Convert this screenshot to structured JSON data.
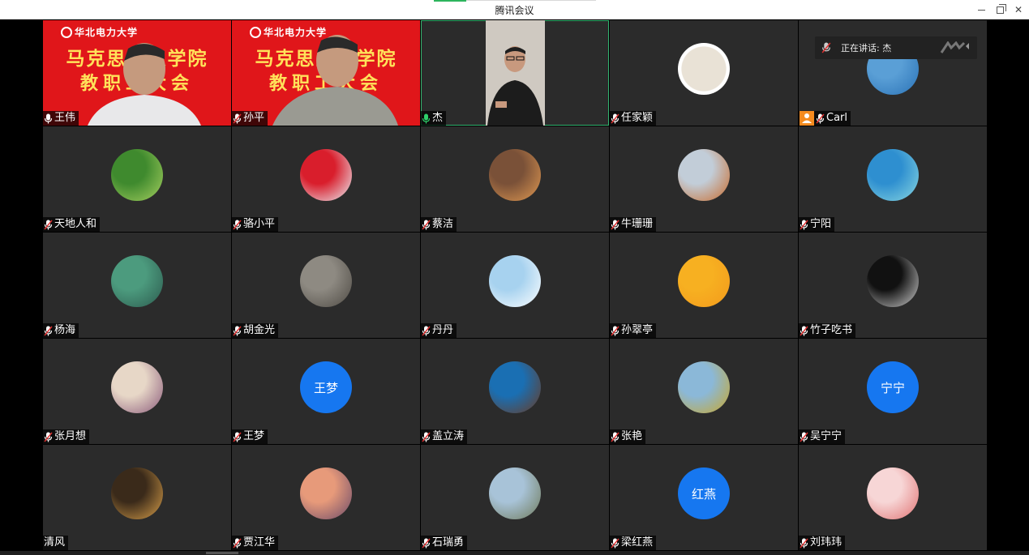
{
  "window": {
    "title": "腾讯会议",
    "controls": [
      "minimize",
      "maximize",
      "close"
    ]
  },
  "speaking": {
    "label": "正在讲话: 杰"
  },
  "participants": [
    {
      "name": "王伟",
      "type": "video-banner",
      "mic": "on"
    },
    {
      "name": "孙平",
      "type": "video-banner",
      "mic": "muted"
    },
    {
      "name": "杰",
      "type": "video",
      "mic": "speaking"
    },
    {
      "name": "任家颖",
      "type": "avatar-image",
      "mic": "muted",
      "colors": [
        "#e9e2d6",
        "#6f6a61"
      ]
    },
    {
      "name": "Carl",
      "type": "avatar-image",
      "mic": "muted",
      "host": true,
      "colors": [
        "#5a9fd6",
        "#2a72b6"
      ]
    },
    {
      "name": "天地人和",
      "type": "avatar-image",
      "mic": "muted",
      "colors": [
        "#3f8a2e",
        "#a7d060"
      ]
    },
    {
      "name": "骆小平",
      "type": "avatar-image",
      "mic": "muted",
      "colors": [
        "#d91e2c",
        "#eaf2f8"
      ]
    },
    {
      "name": "蔡洁",
      "type": "avatar-image",
      "mic": "muted",
      "colors": [
        "#7a5138",
        "#e29a52"
      ]
    },
    {
      "name": "牛珊珊",
      "type": "avatar-image",
      "mic": "muted",
      "colors": [
        "#c2cdd8",
        "#c96a2a"
      ]
    },
    {
      "name": "宁阳",
      "type": "avatar-image",
      "mic": "muted",
      "colors": [
        "#2e8fd0",
        "#8ad7e0"
      ]
    },
    {
      "name": "杨海",
      "type": "avatar-image",
      "mic": "muted",
      "colors": [
        "#4c9b7e",
        "#2c5a4e"
      ]
    },
    {
      "name": "胡金光",
      "type": "avatar-image",
      "mic": "muted",
      "colors": [
        "#8e8a82",
        "#4e4a44"
      ]
    },
    {
      "name": "丹丹",
      "type": "avatar-image",
      "mic": "muted",
      "colors": [
        "#a7d2ef",
        "#ffffff"
      ]
    },
    {
      "name": "孙翠亭",
      "type": "avatar-image",
      "mic": "muted",
      "colors": [
        "#f7b021",
        "#f39a1c"
      ]
    },
    {
      "name": "竹子吃书",
      "type": "avatar-image",
      "mic": "muted",
      "colors": [
        "#111111",
        "#d0d0d0"
      ]
    },
    {
      "name": "张月想",
      "type": "avatar-image",
      "mic": "muted",
      "colors": [
        "#e7d7c7",
        "#8a5a7a"
      ]
    },
    {
      "name": "王梦",
      "type": "avatar-text",
      "mic": "muted",
      "avatar_text": "王梦"
    },
    {
      "name": "盖立涛",
      "type": "avatar-image",
      "mic": "muted",
      "colors": [
        "#1a6fb3",
        "#6b3a22"
      ]
    },
    {
      "name": "张艳",
      "type": "avatar-image",
      "mic": "muted",
      "colors": [
        "#8bb8d8",
        "#c9a72a"
      ]
    },
    {
      "name": "吴宁宁",
      "type": "avatar-text",
      "mic": "muted",
      "avatar_text": "宁宁"
    },
    {
      "name": "清风",
      "type": "avatar-image",
      "mic": "none",
      "colors": [
        "#3a2a1a",
        "#d9a04a"
      ]
    },
    {
      "name": "贾江华",
      "type": "avatar-image",
      "mic": "muted",
      "colors": [
        "#e79a7a",
        "#6a4a6a"
      ]
    },
    {
      "name": "石瑞勇",
      "type": "avatar-image",
      "mic": "muted",
      "colors": [
        "#a8c3d8",
        "#6f7a5a"
      ]
    },
    {
      "name": "梁红燕",
      "type": "avatar-text",
      "mic": "muted",
      "avatar_text": "红燕"
    },
    {
      "name": "刘玮玮",
      "type": "avatar-image",
      "mic": "muted",
      "colors": [
        "#f7d6d6",
        "#e07272"
      ]
    }
  ],
  "banner": {
    "logo_text": "华北电力大学",
    "line1": "马克思主义学院",
    "line2": "教职工大会"
  },
  "colors": {
    "tile_bg": "#2b2b2b",
    "text_avatar_bg": "#1677f0",
    "banner_red": "#e0161a",
    "banner_yellow": "#ffe25a",
    "active_border": "#33b370",
    "host_badge": "#f58b1f"
  }
}
